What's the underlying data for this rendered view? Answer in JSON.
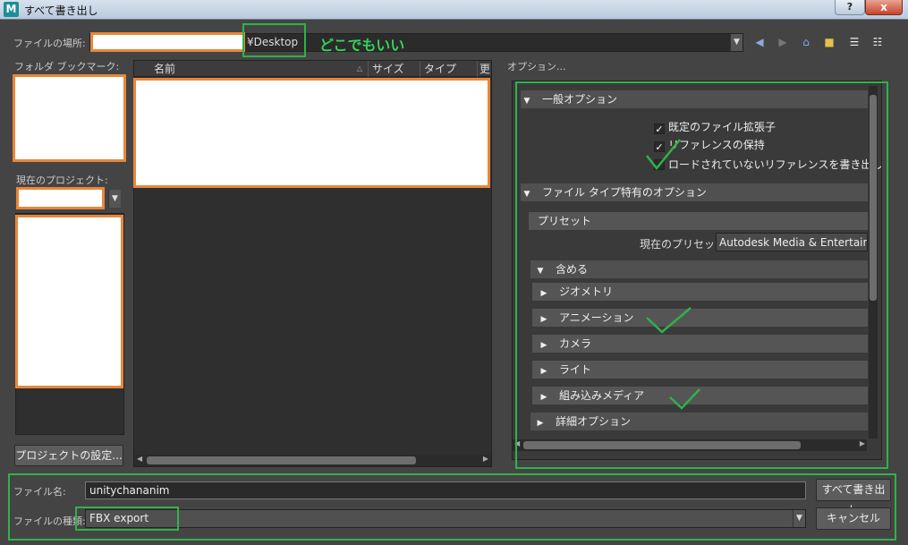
{
  "window": {
    "title": "すべて書き出し",
    "app_icon": "M",
    "help": "?",
    "close": "x"
  },
  "location": {
    "label": "ファイルの場所:",
    "path_suffix": "¥Desktop",
    "annotation": "どこでもいい"
  },
  "bookmarks": {
    "label": "フォルダ ブックマーク:"
  },
  "project": {
    "label": "現在のプロジェクト:",
    "settings_button": "プロジェクトの設定..."
  },
  "file_list": {
    "columns": [
      "名前",
      "サイズ",
      "タイプ",
      "更"
    ]
  },
  "options": {
    "title": "オプション...",
    "general": {
      "label": "一般オプション",
      "checks": [
        {
          "label": "既定のファイル拡張子",
          "checked": true
        },
        {
          "label": "リファレンスの保持",
          "checked": true
        },
        {
          "label": "ロードされていないリファレンスを書き出し",
          "checked": false
        }
      ]
    },
    "filetype": {
      "label": "ファイル タイプ特有のオプション"
    },
    "preset": {
      "label": "プリセット",
      "current_label": "現在のプリセット:",
      "current_value": "Autodesk Media & Entertainm"
    },
    "include": {
      "label": "含める",
      "items": [
        "ジオメトリ",
        "アニメーション",
        "カメラ",
        "ライト",
        "組み込みメディア"
      ]
    },
    "advanced": {
      "label": "詳細オプション"
    }
  },
  "bottom": {
    "filename_label": "ファイル名:",
    "filename_value": "unitychananim",
    "filetype_label": "ファイルの種類:",
    "filetype_value": "FBX export",
    "export_button": "すべて書き出し",
    "cancel_button": "キャンセル"
  },
  "colors": {
    "annotation_green": "#2fb24a",
    "redaction_orange": "#e7873a"
  }
}
